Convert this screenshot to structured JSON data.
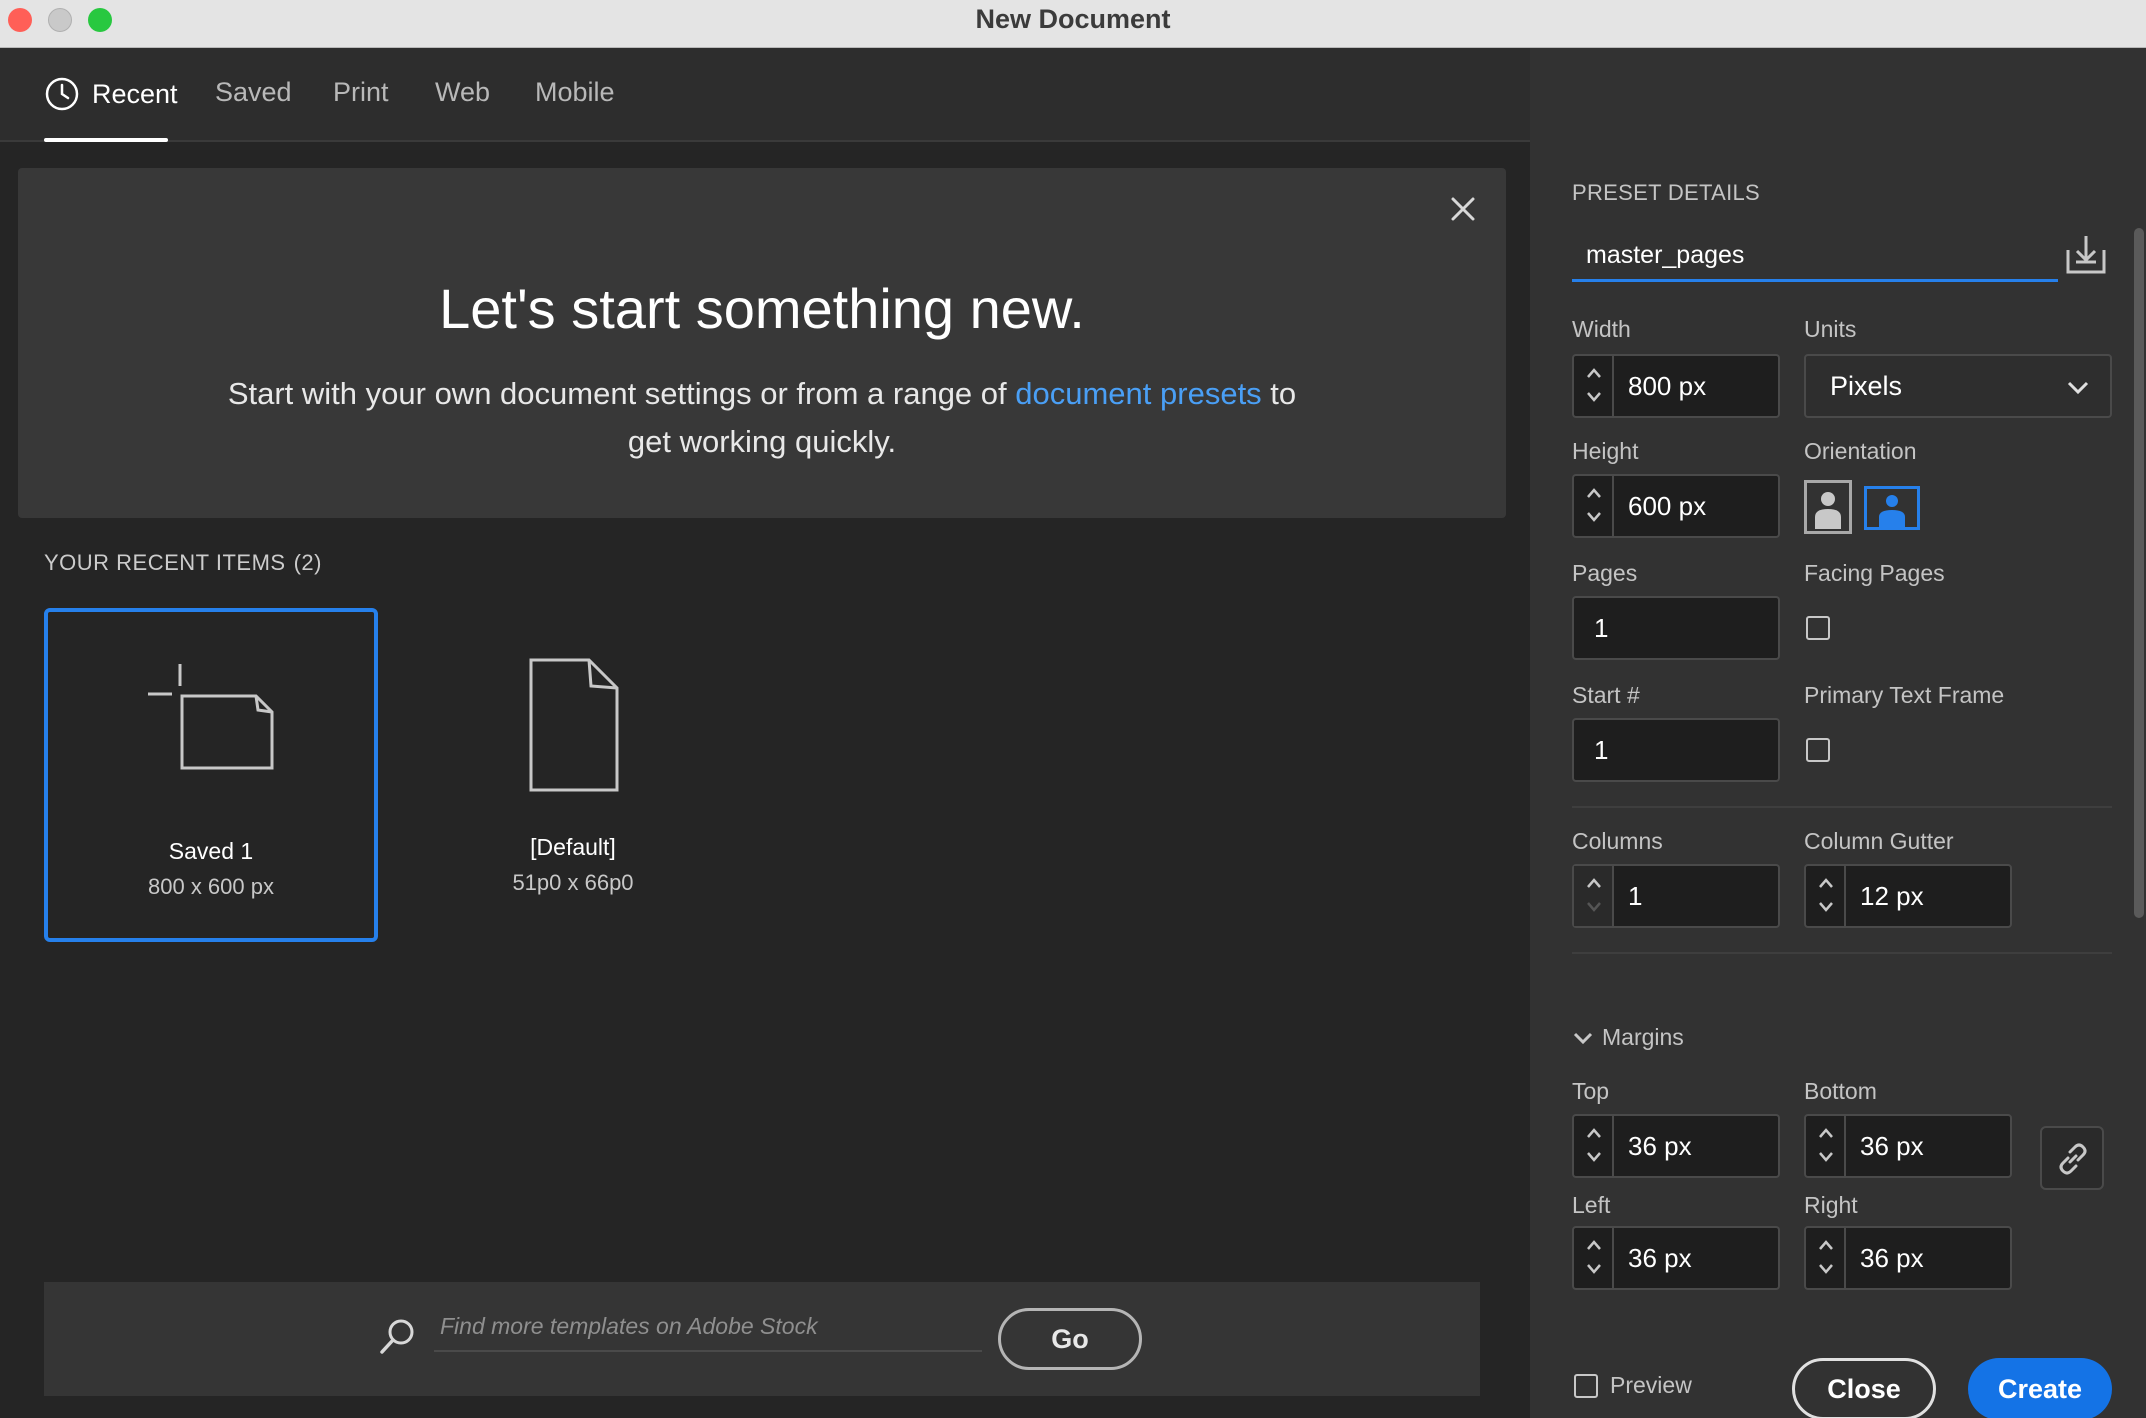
{
  "window": {
    "title": "New Document"
  },
  "tabs": [
    {
      "label": "Recent",
      "active": true
    },
    {
      "label": "Saved"
    },
    {
      "label": "Print"
    },
    {
      "label": "Web"
    },
    {
      "label": "Mobile"
    }
  ],
  "hero": {
    "title": "Let's start something new.",
    "text_before": "Start with your own document settings or from a range of ",
    "link": "document presets",
    "text_after": " to get working quickly."
  },
  "recent": {
    "label": "YOUR RECENT ITEMS",
    "count": "(2)",
    "items": [
      {
        "name": "Saved 1",
        "size": "800 x 600 px",
        "selected": true
      },
      {
        "name": "[Default]",
        "size": "51p0 x 66p0"
      }
    ]
  },
  "stock": {
    "placeholder": "Find more templates on Adobe Stock",
    "go_label": "Go"
  },
  "preset": {
    "header": "PRESET DETAILS",
    "name": "master_pages",
    "width_label": "Width",
    "width": "800 px",
    "units_label": "Units",
    "units": "Pixels",
    "height_label": "Height",
    "height": "600 px",
    "orientation_label": "Orientation",
    "orientation": "landscape",
    "pages_label": "Pages",
    "pages": "1",
    "facing_label": "Facing Pages",
    "start_label": "Start #",
    "start": "1",
    "primary_frame_label": "Primary Text Frame",
    "columns_label": "Columns",
    "columns": "1",
    "gutter_label": "Column Gutter",
    "gutter": "12 px",
    "margins_label": "Margins",
    "top_label": "Top",
    "top": "36 px",
    "bottom_label": "Bottom",
    "bottom": "36 px",
    "left_label": "Left",
    "left": "36 px",
    "right_label": "Right",
    "right": "36 px"
  },
  "footer": {
    "preview_label": "Preview",
    "close_label": "Close",
    "create_label": "Create"
  },
  "colors": {
    "accent": "#2680eb",
    "create": "#1473e6",
    "link": "#4a9ff5"
  }
}
